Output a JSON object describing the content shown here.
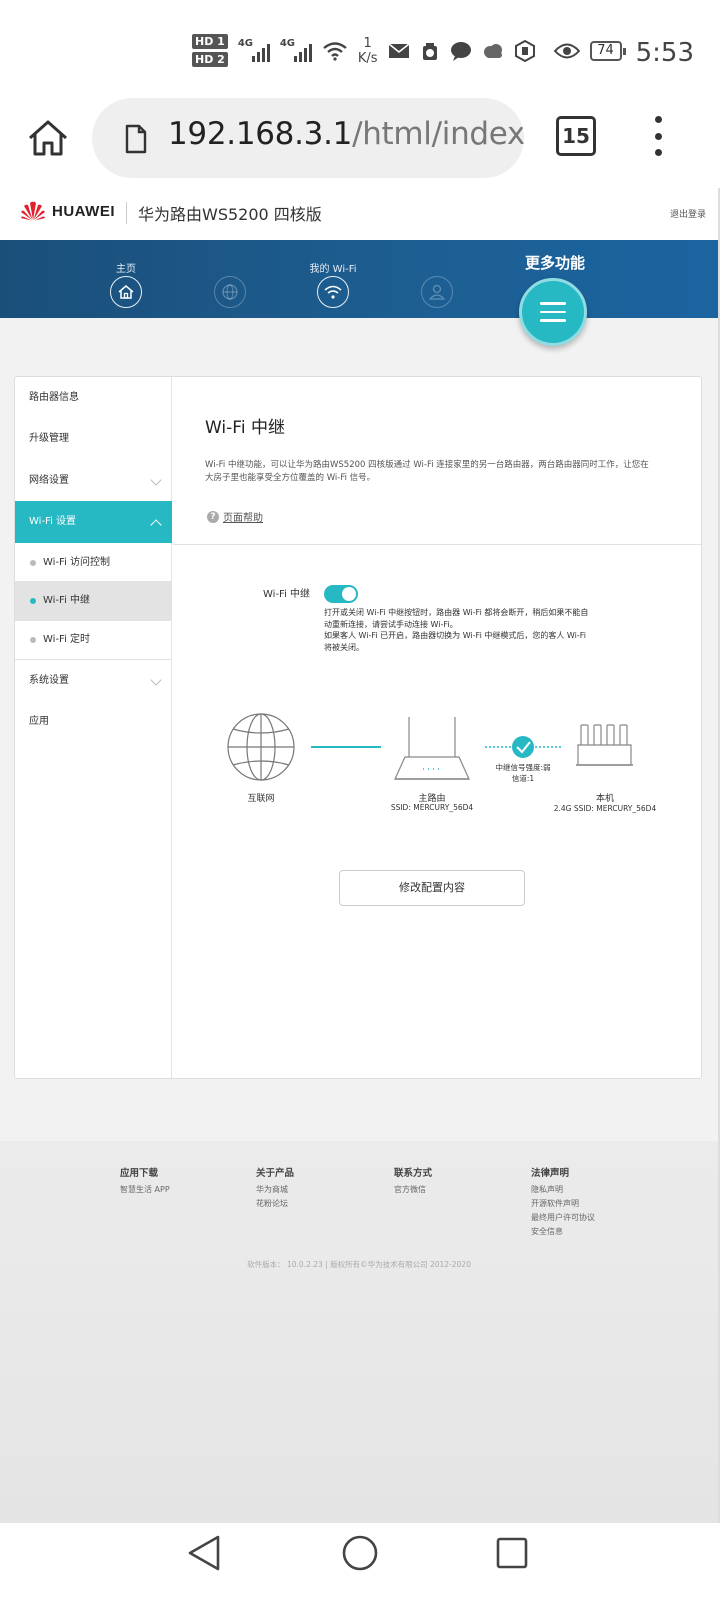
{
  "status_bar": {
    "hd1": "HD 1",
    "hd2": "HD 2",
    "net1": "4G",
    "net2": "4G",
    "speed_value": "1",
    "speed_unit": "K/s",
    "battery": "74",
    "time": "5:53",
    "icons": [
      "wifi-icon",
      "mail-icon",
      "app-icon",
      "chat-icon",
      "cloud-icon",
      "shield-icon",
      "eye-icon"
    ]
  },
  "browser": {
    "url_host": "192.168.3.1",
    "url_path": "/html/index",
    "tab_count": "15"
  },
  "router_header": {
    "brand": "HUAWEI",
    "product": "华为路由WS5200 四核版",
    "logout": "退出登录"
  },
  "top_nav": {
    "home_label": "主页",
    "wifi_label": "我的 Wi-Fi",
    "more_label": "更多功能"
  },
  "sidebar": {
    "router_info": "路由器信息",
    "upgrade": "升级管理",
    "network": "网络设置",
    "wifi_settings": "Wi-Fi 设置",
    "wifi_access": "Wi-Fi 访问控制",
    "wifi_relay": "Wi-Fi 中继",
    "wifi_timer": "Wi-Fi 定时",
    "system": "系统设置",
    "apps": "应用"
  },
  "content": {
    "title": "Wi-Fi 中继",
    "description": "Wi-Fi 中继功能，可以让华为路由WS5200 四核版通过 Wi-Fi 连接家里的另一台路由器，两台路由器同时工作，让您在大房子里也能享受全方位覆盖的 Wi-Fi 信号。",
    "help": "页面帮助",
    "toggle_label": "Wi-Fi 中继",
    "toggle_on": true,
    "toggle_note_1": "打开或关闭 Wi-Fi 中继按钮时，路由器 Wi-Fi 都将会断开，稍后如果不能自动重新连接，请尝试手动连接 Wi-Fi。",
    "toggle_note_2": "如果客人 Wi-Fi 已开启，路由器切换为 Wi-Fi 中继模式后，您的客人 Wi-Fi 将被关闭。",
    "internet": "互联网",
    "main_router": "主路由",
    "main_ssid": "SSID: MERCURY_56D4",
    "signal": "中继信号强度:弱",
    "channel": "信道:1",
    "this_device": "本机",
    "this_ssid": "2.4G SSID:  MERCURY_56D4",
    "modify_button": "修改配置内容"
  },
  "footer": {
    "col1_head": "应用下载",
    "col1_links": [
      "智慧生活 APP"
    ],
    "col2_head": "关于产品",
    "col2_links": [
      "华为商城",
      "花粉论坛"
    ],
    "col3_head": "联系方式",
    "col3_links": [
      "官方微信"
    ],
    "col4_head": "法律声明",
    "col4_links": [
      "隐私声明",
      "开源软件声明",
      "最终用户许可协议",
      "安全信息"
    ],
    "copyright": "软件版本：  10.0.2.23 | 版权所有©华为技术有限公司 2012-2020"
  },
  "colors": {
    "accent": "#27b9c3",
    "nav_blue": "#1d5f93"
  }
}
